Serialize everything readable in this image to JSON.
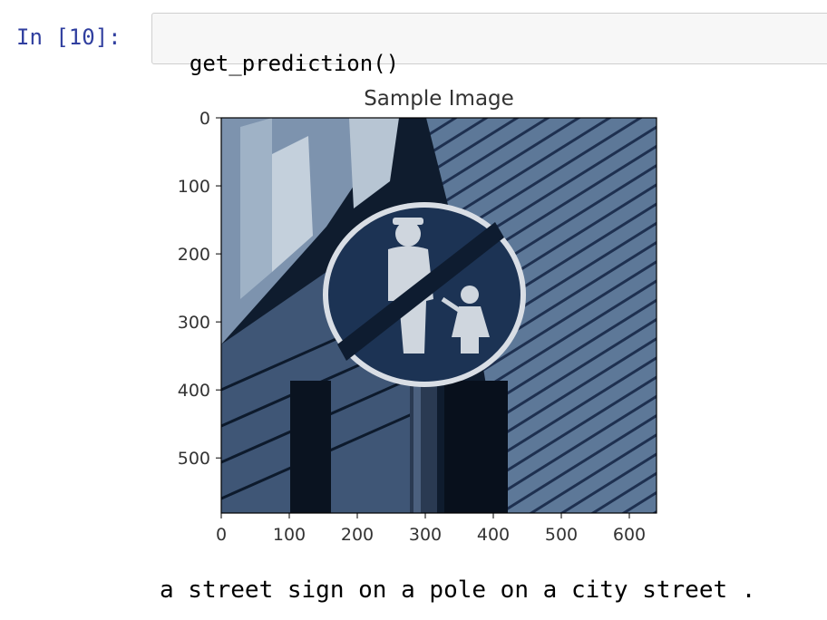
{
  "cell": {
    "prompt": "In [10]:",
    "code": "get_prediction()"
  },
  "figure": {
    "title": "Sample Image",
    "x_ticks": [
      "0",
      "100",
      "200",
      "300",
      "400",
      "500",
      "600"
    ],
    "y_ticks": [
      "0",
      "100",
      "200",
      "300",
      "400",
      "500"
    ],
    "image_description_colors": {
      "sign_blue": "#1c3354",
      "pictogram": "#cfd6de",
      "wall": "#5a7392",
      "dark": "#0d1a2c"
    }
  },
  "output": {
    "caption": "a street sign on a pole on a city street ."
  }
}
